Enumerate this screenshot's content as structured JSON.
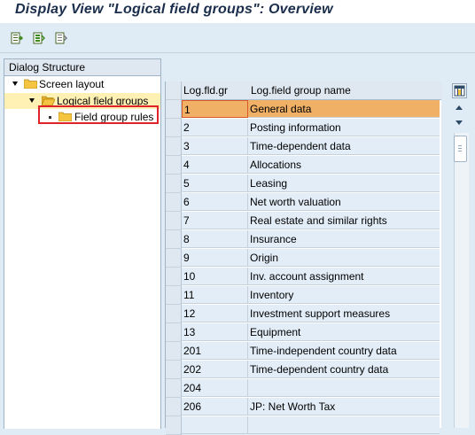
{
  "window": {
    "title": "Display View \"Logical field groups\": Overview"
  },
  "toolbar": {
    "buttons": [
      {
        "name": "choose-details-icon"
      },
      {
        "name": "select-all-icon"
      },
      {
        "name": "deselect-all-icon"
      }
    ]
  },
  "dialog_structure": {
    "header": "Dialog Structure",
    "items": [
      {
        "label": "Screen layout",
        "level": 0,
        "expanded": true
      },
      {
        "label": "Logical field groups",
        "level": 1,
        "expanded": true,
        "selected": true
      },
      {
        "label": "Field group rules",
        "level": 2,
        "expanded": false
      }
    ]
  },
  "table": {
    "columns": [
      "Log.fld.gr",
      "Log.field group name"
    ],
    "rows": [
      {
        "code": "1",
        "name": "General data",
        "active": true
      },
      {
        "code": "2",
        "name": "Posting information"
      },
      {
        "code": "3",
        "name": "Time-dependent data"
      },
      {
        "code": "4",
        "name": "Allocations"
      },
      {
        "code": "5",
        "name": "Leasing"
      },
      {
        "code": "6",
        "name": "Net worth valuation"
      },
      {
        "code": "7",
        "name": "Real estate and similar rights"
      },
      {
        "code": "8",
        "name": "Insurance"
      },
      {
        "code": "9",
        "name": "Origin"
      },
      {
        "code": "10",
        "name": "Inv. account assignment"
      },
      {
        "code": "11",
        "name": "Inventory"
      },
      {
        "code": "12",
        "name": "Investment support measures"
      },
      {
        "code": "13",
        "name": "Equipment"
      },
      {
        "code": "201",
        "name": "Time-independent country data"
      },
      {
        "code": "202",
        "name": "Time-dependent country data"
      },
      {
        "code": "204",
        "name": ""
      },
      {
        "code": "206",
        "name": "JP: Net Worth Tax"
      },
      {
        "code": "",
        "name": ""
      }
    ]
  },
  "colors": {
    "active_row": "#f0b066",
    "highlight_box": "#e0232b",
    "folder": "#f5c542",
    "selected_tree_item": "#fff0b3"
  }
}
